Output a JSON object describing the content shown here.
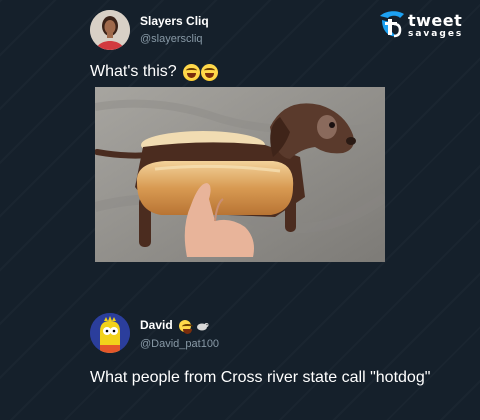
{
  "brand": {
    "logo_word": "tweet",
    "logo_sub": "savages"
  },
  "tweets": [
    {
      "name": "Slayers Cliq",
      "handle": "@slayerscliq",
      "text": "What's this?",
      "emoji": [
        "face-with-tears-of-joy-icon",
        "face-with-tears-of-joy-icon"
      ],
      "photo_alt": "Dachshund puppy in a hotdog bun"
    },
    {
      "name": "David",
      "handle": "@David_pat100",
      "name_icons": [
        "smiling-face-icon",
        "small-animal-icon"
      ],
      "text": "What people from Cross river state call \"hotdog\""
    }
  ],
  "colors": {
    "background": "#15202b",
    "secondary_text": "#8899a6",
    "logo_accent": "#1da1f2"
  }
}
